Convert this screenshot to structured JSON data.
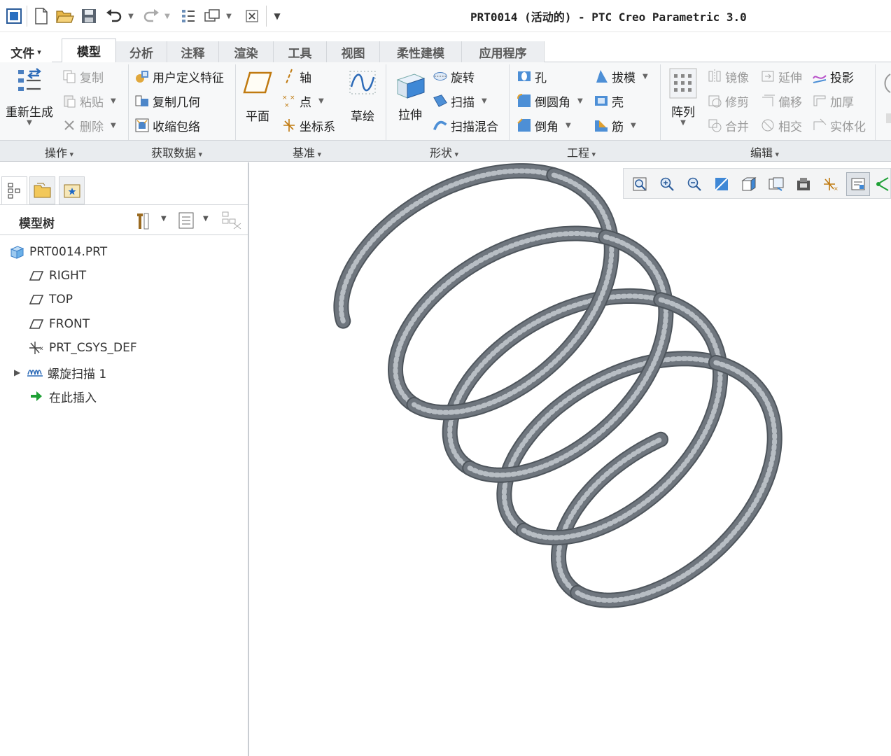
{
  "window": {
    "title": "PRT0014 (活动的) - PTC Creo Parametric 3.0"
  },
  "tabs": [
    {
      "label": "文件",
      "has_menu": true
    },
    {
      "label": "模型",
      "active": true
    },
    {
      "label": "分析"
    },
    {
      "label": "注释"
    },
    {
      "label": "渲染"
    },
    {
      "label": "工具"
    },
    {
      "label": "视图"
    },
    {
      "label": "柔性建模"
    },
    {
      "label": "应用程序"
    }
  ],
  "ribbon": {
    "operations": {
      "regenerate": "重新生成",
      "copy": "复制",
      "paste": "粘贴",
      "delete": "删除"
    },
    "get_data": {
      "udf": "用户定义特征",
      "copy_geom": "复制几何",
      "shrinkwrap": "收缩包络"
    },
    "datum": {
      "plane": "平面",
      "axis": "轴",
      "point": "点",
      "csys": "坐标系",
      "sketch": "草绘"
    },
    "shapes": {
      "extrude": "拉伸",
      "revolve": "旋转",
      "sweep": "扫描",
      "swept_blend": "扫描混合"
    },
    "engineering": {
      "hole": "孔",
      "round": "倒圆角",
      "chamfer": "倒角",
      "draft": "拔模",
      "shell": "壳",
      "rib": "筋"
    },
    "editing": {
      "pattern": "阵列",
      "mirror": "镜像",
      "extend": "延伸",
      "project": "投影",
      "trim": "修剪",
      "offset": "偏移",
      "thicken": "加厚",
      "merge": "合并",
      "intersect": "相交",
      "solidify": "实体化"
    },
    "groups": [
      "操作",
      "获取数据",
      "基准",
      "形状",
      "工程",
      "编辑"
    ]
  },
  "model_tree": {
    "title": "模型树",
    "items": [
      {
        "label": "PRT0014.PRT",
        "icon": "part-icon"
      },
      {
        "label": "RIGHT",
        "icon": "datum-plane-icon"
      },
      {
        "label": "TOP",
        "icon": "datum-plane-icon"
      },
      {
        "label": "FRONT",
        "icon": "datum-plane-icon"
      },
      {
        "label": "PRT_CSYS_DEF",
        "icon": "csys-icon"
      },
      {
        "label": "螺旋扫描 1",
        "icon": "helical-sweep-icon",
        "expandable": true
      },
      {
        "label": "在此插入",
        "icon": "insert-here-arrow-icon"
      }
    ]
  },
  "graphics": {
    "model": "helical-rope-spring",
    "colors": {
      "model": "#6f767e",
      "highlight": "#b8bec4"
    }
  }
}
